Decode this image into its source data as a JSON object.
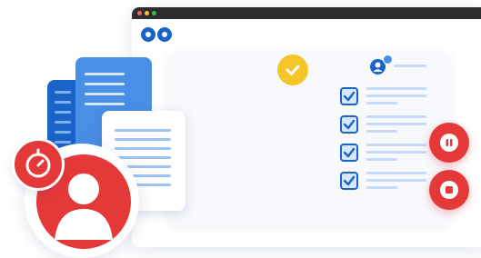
{
  "colors": {
    "primary_blue": "#1a63c9",
    "light_blue": "#4a8fe6",
    "accent_yellow": "#f6c528",
    "record_red": "#e53939",
    "window_bar": "#2d2d2d"
  },
  "icons": {
    "app_logo": "double-circle-logo-icon",
    "approved": "checkmark-icon",
    "reviewer": "user-avatar-icon",
    "pause": "pause-icon",
    "stop": "stop-icon",
    "timer": "stopwatch-icon",
    "user": "user-profile-icon"
  },
  "checklist": {
    "items": [
      {
        "checked": true
      },
      {
        "checked": true
      },
      {
        "checked": true
      },
      {
        "checked": true
      }
    ]
  }
}
